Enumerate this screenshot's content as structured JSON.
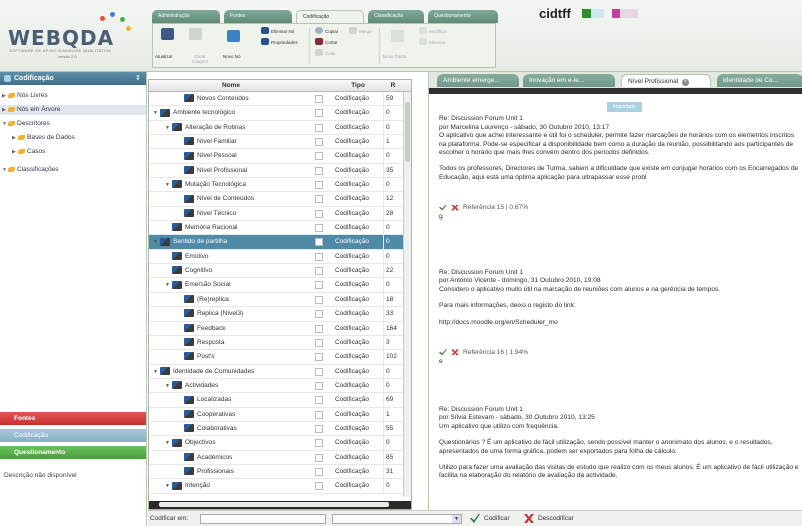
{
  "app": {
    "logo_text": "WEBQDA",
    "logo_tagline": "SOFTWARE DE APOIO À ANÁLISE QUALITATIVA",
    "logo_version": "versão 2.0",
    "user": "cidtff"
  },
  "main_tabs": [
    "Administração",
    "Fontes",
    "Codificação",
    "Classificação",
    "Questionamento"
  ],
  "ribbon": {
    "atualizar": "Atualizar",
    "gerar_imagem": "Gerar Imagem",
    "novo_no": "Novo Nó",
    "eliminar_no": "Eliminar Nó",
    "propriedades": "Propriedades",
    "copiar": "Copiar",
    "cortar": "Cortar",
    "colar": "Colar",
    "merge": "Merge",
    "nova_pasta": "Nova Pasta",
    "modificar": "Modificar",
    "eliminar": "Eliminar"
  },
  "sidebar": {
    "title": "Codificação",
    "items": [
      {
        "label": "Nós Livres",
        "arrow": "▶",
        "indent": 0
      },
      {
        "label": "Nós em Árvore",
        "arrow": "▶",
        "indent": 0,
        "selected": true
      },
      {
        "label": "Descritores",
        "arrow": "▼",
        "indent": 0
      },
      {
        "label": "Bases de Dados",
        "arrow": "▶",
        "indent": 1
      },
      {
        "label": "Casos",
        "arrow": "▶",
        "indent": 1
      },
      {
        "label": "Classificações",
        "arrow": "▼",
        "indent": 0
      }
    ],
    "panel_fontes": "Fontes",
    "panel_codificacao": "Codificação",
    "panel_questionamento": "Questionamento",
    "description": "Descrição não disponível"
  },
  "table": {
    "headers": {
      "name": "Nome",
      "type": "Tipo",
      "refs": "R"
    },
    "rows": [
      {
        "name": "Novos Conteúdos",
        "level": 2,
        "type": "Codificação",
        "refs": "59"
      },
      {
        "name": "Ambiente tecnológico",
        "level": 0,
        "expand": "▼",
        "type": "Codificação",
        "refs": "0"
      },
      {
        "name": "Alteração de Rotinas",
        "level": 1,
        "expand": "▼",
        "type": "Codificação",
        "refs": "0"
      },
      {
        "name": "Nível Familiar",
        "level": 2,
        "type": "Codificação",
        "refs": "1"
      },
      {
        "name": "Nível Pessoal",
        "level": 2,
        "type": "Codificação",
        "refs": "0"
      },
      {
        "name": "Nível Profissional",
        "level": 2,
        "type": "Codificação",
        "refs": "35"
      },
      {
        "name": "Mutação Tecnológica",
        "level": 1,
        "expand": "▼",
        "type": "Codificação",
        "refs": "0"
      },
      {
        "name": "Nível de Conteúdos",
        "level": 2,
        "type": "Codificação",
        "refs": "12"
      },
      {
        "name": "Nível Técnico",
        "level": 2,
        "type": "Codificação",
        "refs": "28"
      },
      {
        "name": "Memória Racional",
        "level": 1,
        "type": "Codificação",
        "refs": "0"
      },
      {
        "name": "Sentido de partilha",
        "level": 0,
        "expand": "▼",
        "type": "Codificação",
        "refs": "0",
        "selected": true
      },
      {
        "name": "Emotivo",
        "level": 1,
        "type": "Codificação",
        "refs": "0"
      },
      {
        "name": "Cognitivo",
        "level": 1,
        "type": "Codificação",
        "refs": "22"
      },
      {
        "name": "Emersão Social",
        "level": 1,
        "expand": "▼",
        "type": "Codificação",
        "refs": "0"
      },
      {
        "name": "(Re)replica",
        "level": 2,
        "type": "Codificação",
        "refs": "18"
      },
      {
        "name": "Replica (Nível3)",
        "level": 2,
        "type": "Codificação",
        "refs": "33"
      },
      {
        "name": "Feedback",
        "level": 2,
        "type": "Codificação",
        "refs": "164"
      },
      {
        "name": "Resposta",
        "level": 2,
        "type": "Codificação",
        "refs": "3"
      },
      {
        "name": "Post's",
        "level": 2,
        "type": "Codificação",
        "refs": "102"
      },
      {
        "name": "Identidade de Comunidades",
        "level": 0,
        "expand": "▼",
        "type": "Codificação",
        "refs": "0"
      },
      {
        "name": "Actividades",
        "level": 1,
        "expand": "▼",
        "type": "Codificação",
        "refs": "0"
      },
      {
        "name": "Localizadas",
        "level": 2,
        "type": "Codificação",
        "refs": "69"
      },
      {
        "name": "Cooperativas",
        "level": 2,
        "type": "Codificação",
        "refs": "1"
      },
      {
        "name": "Colaborativas",
        "level": 2,
        "type": "Codificação",
        "refs": "55"
      },
      {
        "name": "Objectivos",
        "level": 1,
        "expand": "▼",
        "type": "Codificação",
        "refs": "0"
      },
      {
        "name": "Académicos",
        "level": 2,
        "type": "Codificação",
        "refs": "85"
      },
      {
        "name": "Profissionais",
        "level": 2,
        "type": "Codificação",
        "refs": "31"
      },
      {
        "name": "Intenção",
        "level": 1,
        "expand": "▼",
        "type": "Codificação",
        "refs": "0"
      }
    ]
  },
  "bottom": {
    "codificar_em": "Codificar em:",
    "codificar": "Codificar",
    "descodificar": "Descodificar"
  },
  "viewer": {
    "tabs": [
      "Ambiente emerge...",
      "Inovação em e-le...",
      "Nível Profissional",
      "Identidade de Co..."
    ],
    "active_tab": 2,
    "imported_label": "Importado",
    "blocks": [
      {
        "lines": [
          "Re: Discussion Forum Unit 1",
          "por Marcelina Lourenço - sábado, 30 Outubro 2010, 13:17",
          "O aplicativo que achei interessante e útil foi o scheduler, permite fazer marcações de horários com os elementos inscritos na plataforma. Pode-se especificar a disponibilidade bem como a duração da reunião, possibilitando aos participantes de escolher o horário que mais lhes convém dentro dos períodos definidos."
        ],
        "extra": "Todos os professores, Directores de Turma, sabem a dificuldade que existe em conjugar horários com os Encarregados de Educação, aqui está uma óptima aplicação para ultrapassar esse probl",
        "reference": "Referência 15  |  0.67%",
        "marker": "g"
      },
      {
        "lines": [
          "Re: Discussion Forum Unit 1",
          "por António Vicente - domingo, 31 Outubro 2010, 19:08",
          "Considero o aplicativo muito útil na marcação de reuniões com alunos e na gerência de tempos."
        ],
        "extra": "Para mais informações, deixo o registo do link:",
        "extra2": "http://docs.moodle.org/en/Scheduler_mo",
        "reference": "Referência 16  |  1.94%",
        "marker": "e"
      },
      {
        "lines": [
          "Re: Discussion Forum Unit 1",
          "por Sílvia Estevam - sábado, 30 Outubro 2010, 13:25",
          "Um aplicativo que utilizo com frequência."
        ],
        "extra": "Questionários ? É um aplicativo de fácil utilização, sendo possível manter o anonimato dos alunos, e o resultados, apresentados de uma forma gráfica, podem ser exportados para folha de cálculo.",
        "extra2": "Utilizo para fazer uma avaliação das visitas de estudo que realizo com os meus alunos. É um aplicativo de fácil utilização e facilita na elaboração do relatório de avaliação da actividade."
      }
    ]
  },
  "colors": {
    "accent": "#4f8aa6",
    "tab_green": "#6e998a",
    "fontes_red": "#d43b3b",
    "codificacao_blue": "#8fb6c8",
    "questionamento_green": "#55a84a"
  }
}
